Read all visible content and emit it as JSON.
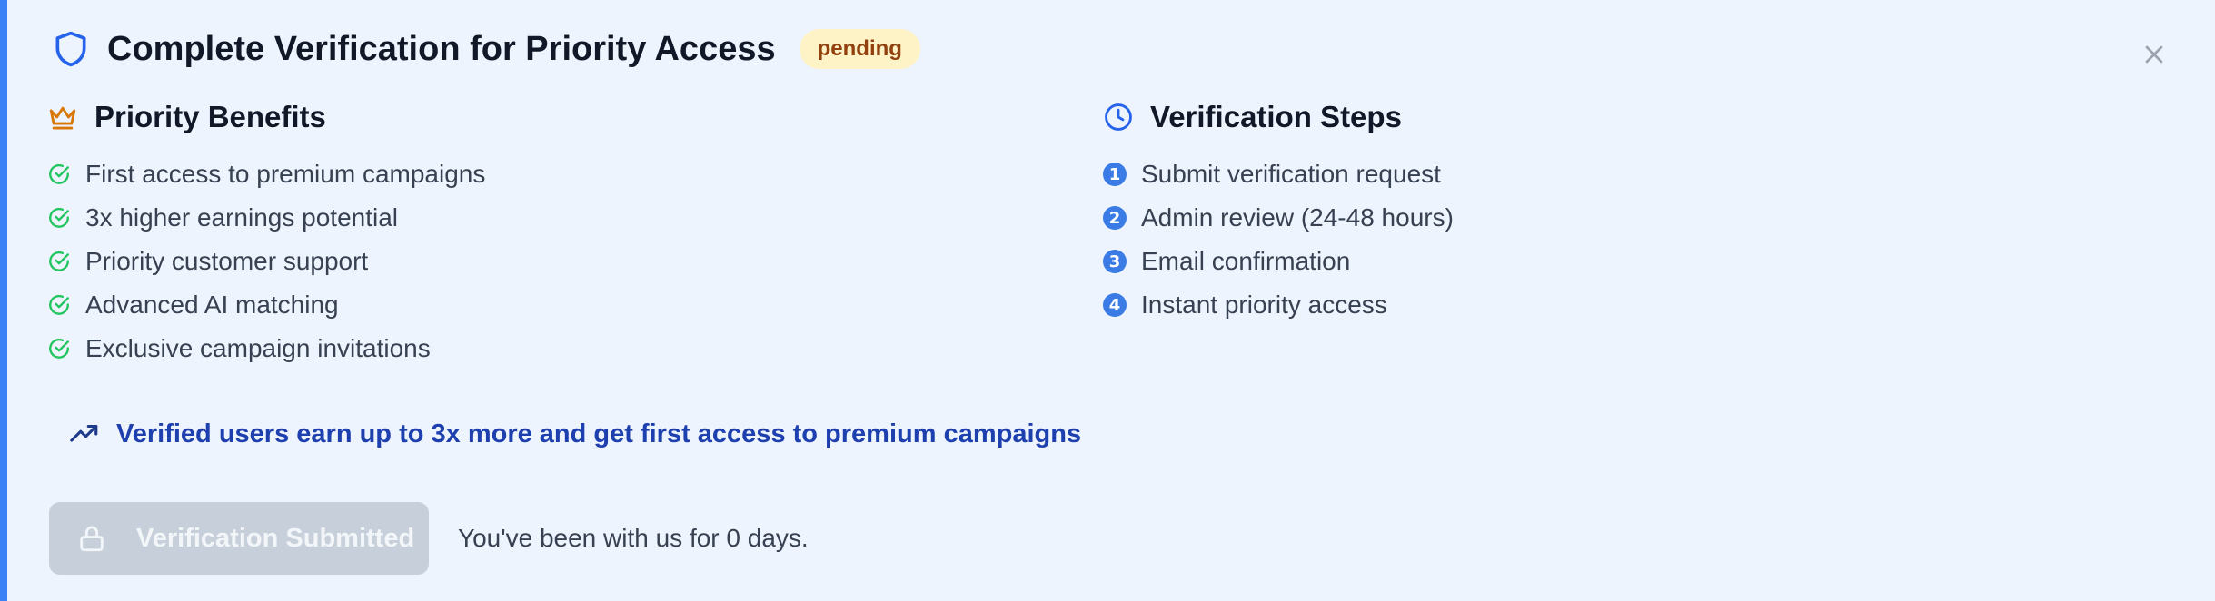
{
  "header": {
    "title": "Complete Verification for Priority Access",
    "status_badge": "pending",
    "close_icon": "close-icon"
  },
  "benefits": {
    "heading": "Priority Benefits",
    "icon": "crown-icon",
    "items": [
      "First access to premium campaigns",
      "3x higher earnings potential",
      "Priority customer support",
      "Advanced AI matching",
      "Exclusive campaign invitations"
    ]
  },
  "steps": {
    "heading": "Verification Steps",
    "icon": "clock-icon",
    "items": [
      {
        "number": "1",
        "label": "Submit verification request"
      },
      {
        "number": "2",
        "label": "Admin review (24-48 hours)"
      },
      {
        "number": "3",
        "label": "Email confirmation"
      },
      {
        "number": "4",
        "label": "Instant priority access"
      }
    ]
  },
  "promo": {
    "icon": "trending-up-icon",
    "text": "Verified users earn up to 3x more and get first access to premium campaigns"
  },
  "footer": {
    "button_label": "Verification Submitted",
    "button_icon": "lock-icon",
    "note": "You've been with us for 0 days."
  },
  "colors": {
    "accent": "#3b82f6",
    "background": "#eef4fe",
    "badge_bg": "#fef3c7",
    "badge_text": "#92400e",
    "check": "#22c55e",
    "crown": "#d97706",
    "promo_text": "#1e40af",
    "disabled_button": "#c7d0da"
  }
}
